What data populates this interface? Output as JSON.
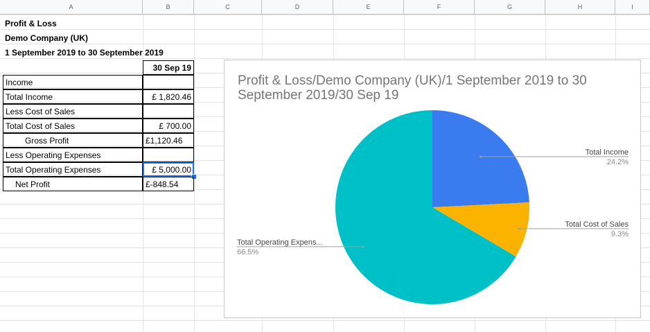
{
  "columns": [
    "A",
    "B",
    "C",
    "D",
    "E",
    "F",
    "G",
    "H",
    "I"
  ],
  "rows": {
    "title": "Profit & Loss",
    "company": "Demo Company (UK)",
    "period": "1 September 2019 to 30 September 2019",
    "header_date": "30 Sep 19",
    "income": "Income",
    "total_income_label": "Total Income",
    "total_income_value": "£ 1,820.46",
    "less_cos": "Less Cost of Sales",
    "total_cos_label": "Total Cost of Sales",
    "total_cos_value": "£ 700.00",
    "gross_profit_label": "Gross Profit",
    "gross_profit_value": "£1,120.46",
    "less_opex": "Less Operating Expenses",
    "total_opex_label": "Total Operating Expenses",
    "total_opex_value": "£ 5,000.00",
    "net_profit_label": "Net Profit",
    "net_profit_value": "£-848.54"
  },
  "chart_data": {
    "type": "pie",
    "title": "Profit & Loss/Demo Company (UK)/1 September 2019 to 30 September 2019/30 Sep 19",
    "slices": [
      {
        "label": "Total Income",
        "percent_label": "24.2%",
        "value": 24.2,
        "color": "#3a7cf0"
      },
      {
        "label": "Total Cost of Sales",
        "percent_label": "9.3%",
        "value": 9.3,
        "color": "#fbb300"
      },
      {
        "label": "Total Operating Expens...",
        "percent_label": "66.5%",
        "value": 66.5,
        "color": "#00c0c7"
      }
    ]
  }
}
